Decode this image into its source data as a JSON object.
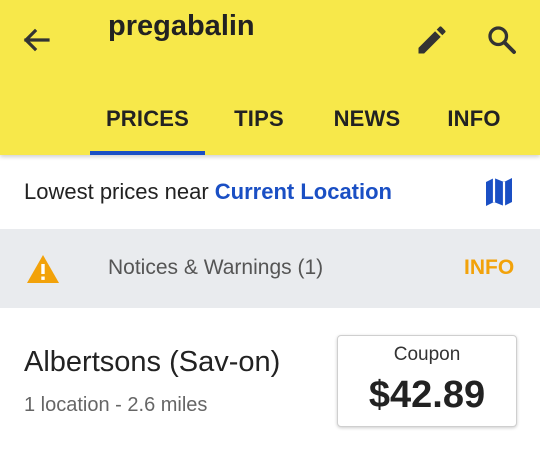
{
  "header": {
    "title": "pregabalin",
    "tabs": [
      {
        "label": "PRICES",
        "active": true
      },
      {
        "label": "TIPS",
        "active": false
      },
      {
        "label": "NEWS",
        "active": false
      },
      {
        "label": "INFO",
        "active": false
      }
    ]
  },
  "location": {
    "prefix": "Lowest prices near ",
    "link": "Current Location"
  },
  "notice": {
    "text": "Notices & Warnings (1)",
    "action": "INFO"
  },
  "pharmacy": {
    "name": "Albertsons (Sav-on)",
    "detail": "1 location - 2.6 miles",
    "price_label": "Coupon",
    "price": "$42.89"
  },
  "icons": [
    "back-arrow-icon",
    "edit-pencil-icon",
    "search-icon",
    "map-icon",
    "warning-icon"
  ],
  "colors": {
    "appbar": "#f7e84a",
    "accent_blue": "#1a4fc4",
    "warning_orange": "#f2a20a"
  }
}
